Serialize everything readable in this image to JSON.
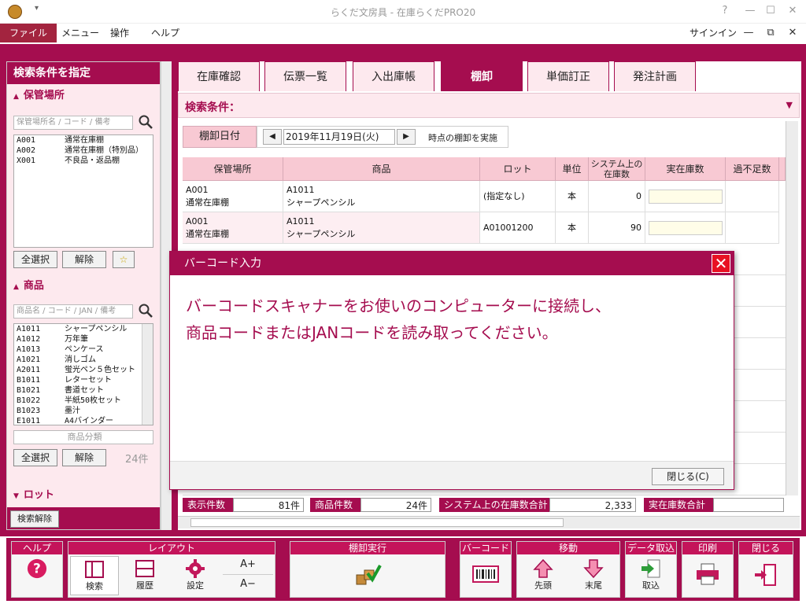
{
  "window": {
    "title": "らくだ文房具 - 在庫らくだPRO20",
    "quick_access": "▾",
    "help": "?",
    "minimize": "—",
    "restore": "☐",
    "close": "✕"
  },
  "menu": {
    "items": [
      "ファイル",
      "メニュー",
      "操作",
      "ヘルプ"
    ],
    "signin": "サインイン",
    "mdi_min": "—",
    "mdi_restore": "⧉",
    "mdi_close": "✕"
  },
  "left": {
    "header": "検索条件を指定",
    "location": {
      "title": "保管場所",
      "placeholder": "保管場所名 / コード / 備考",
      "rows": [
        [
          "A001",
          "通常在庫棚"
        ],
        [
          "A002",
          "通常在庫棚（特別品）"
        ],
        [
          "X001",
          "不良品・返品棚"
        ]
      ],
      "select_all": "全選択",
      "clear": "解除"
    },
    "product": {
      "title": "商品",
      "placeholder": "商品名 / コード / JAN / 備考",
      "rows": [
        [
          "A1011",
          "シャープペンシル"
        ],
        [
          "A1012",
          "万年筆"
        ],
        [
          "A1013",
          "ペンケース"
        ],
        [
          "A1021",
          "消しゴム"
        ],
        [
          "A2011",
          "蛍光ペン５色セット"
        ],
        [
          "B1011",
          "レターセット"
        ],
        [
          "B1021",
          "書道セット"
        ],
        [
          "B1022",
          "半紙50枚セット"
        ],
        [
          "B1023",
          "墨汁"
        ],
        [
          "E1011",
          "A4バインダー"
        ]
      ],
      "category": "商品分類",
      "select_all": "全選択",
      "clear": "解除",
      "count": "24件"
    },
    "lot": {
      "title": "ロット"
    },
    "clear_search": "検索解除"
  },
  "tabs": [
    "在庫確認",
    "伝票一覧",
    "入出庫帳",
    "棚卸",
    "単価訂正",
    "発注計画"
  ],
  "active_tab": "棚卸",
  "search": {
    "label": "検索条件：",
    "collapse": "▼"
  },
  "date": {
    "label": "棚卸日付",
    "value": "2019年11月19日(火)",
    "suffix": "時点の棚卸を実施",
    "prev": "◀",
    "next": "▶"
  },
  "table": {
    "headers": [
      "保管場所",
      "商品",
      "ロット",
      "単位",
      "システム上の在庫数",
      "実在庫数",
      "過不足数"
    ],
    "rows": [
      {
        "loc_code": "A001",
        "loc_name": "通常在庫棚",
        "prod_code": "A1011",
        "prod_name": "シャープペンシル",
        "lot": "(指定なし)",
        "unit": "本",
        "system_qty": "0"
      },
      {
        "loc_code": "A001",
        "loc_name": "通常在庫棚",
        "prod_code": "A1011",
        "prod_name": "シャープペンシル",
        "lot": "A01001200",
        "unit": "本",
        "system_qty": "90"
      }
    ]
  },
  "status": {
    "display_count_label": "表示件数",
    "display_count": "81件",
    "product_count_label": "商品件数",
    "product_count": "24件",
    "system_total_label": "システム上の在庫数合計",
    "system_total": "2,333",
    "actual_total_label": "実在庫数合計"
  },
  "dialog": {
    "title": "バーコード入力",
    "line1": "バーコードスキャナーをお使いのコンピューターに接続し、",
    "line2": "商品コードまたはJANコードを読み取ってください。",
    "close_button": "閉じる(C)",
    "close_x": "✕"
  },
  "toolbar": {
    "help_group": "ヘルプ",
    "layout_group": "レイアウト",
    "search": "検索",
    "history": "履歴",
    "settings": "設定",
    "font_up": "A+",
    "font_down": "A−",
    "stocktake_group": "棚卸実行",
    "barcode_group": "バーコード",
    "move_group": "移動",
    "first": "先頭",
    "last": "末尾",
    "import_group": "データ取込",
    "import": "取込",
    "print_group": "印刷",
    "close_group": "閉じる"
  }
}
